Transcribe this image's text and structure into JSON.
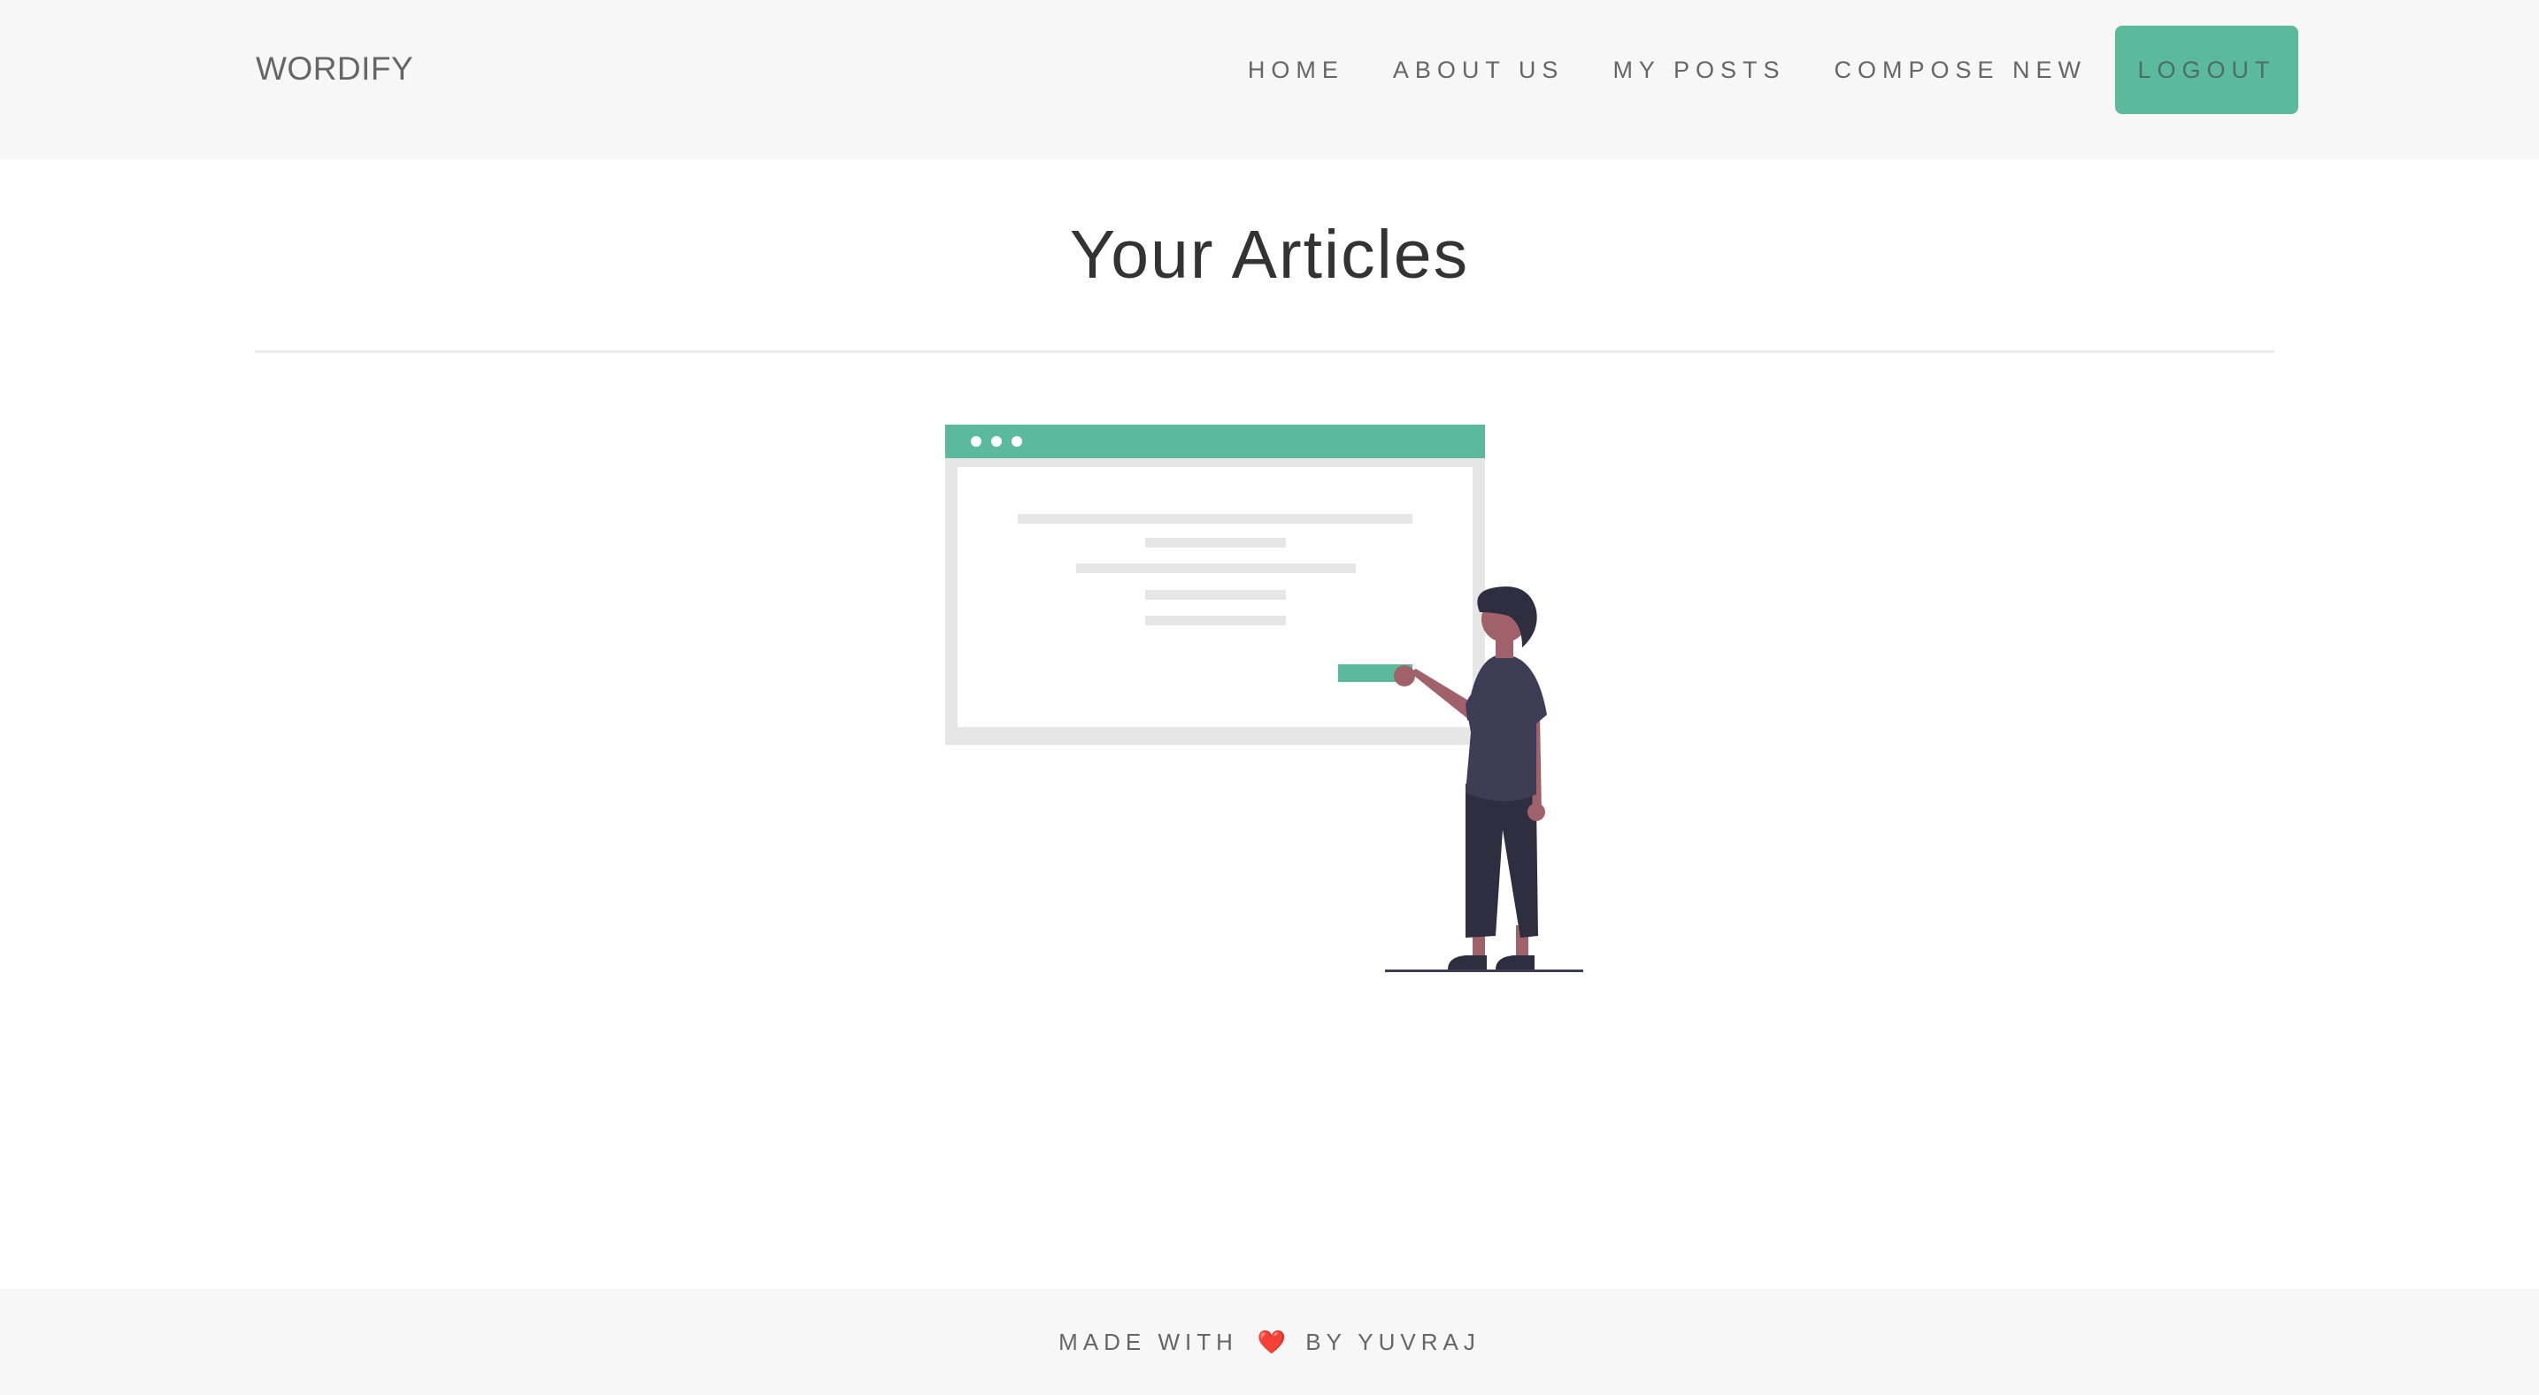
{
  "header": {
    "brand": "WORDIFY",
    "nav": {
      "home": "HOME",
      "about": "ABOUT US",
      "my_posts": "MY POSTS",
      "compose": "COMPOSE NEW",
      "logout": "LOGOUT"
    }
  },
  "main": {
    "title": "Your Articles",
    "illustration_icon": "empty-articles-illustration"
  },
  "footer": {
    "made_with": "MADE WITH",
    "heart_icon": "heart-icon",
    "by": "BY YUVRAJ"
  },
  "colors": {
    "accent": "#5bba9b",
    "header_bg": "#f7f7f7",
    "text": "#666666",
    "title": "#333333",
    "heart": "#e0202a"
  }
}
